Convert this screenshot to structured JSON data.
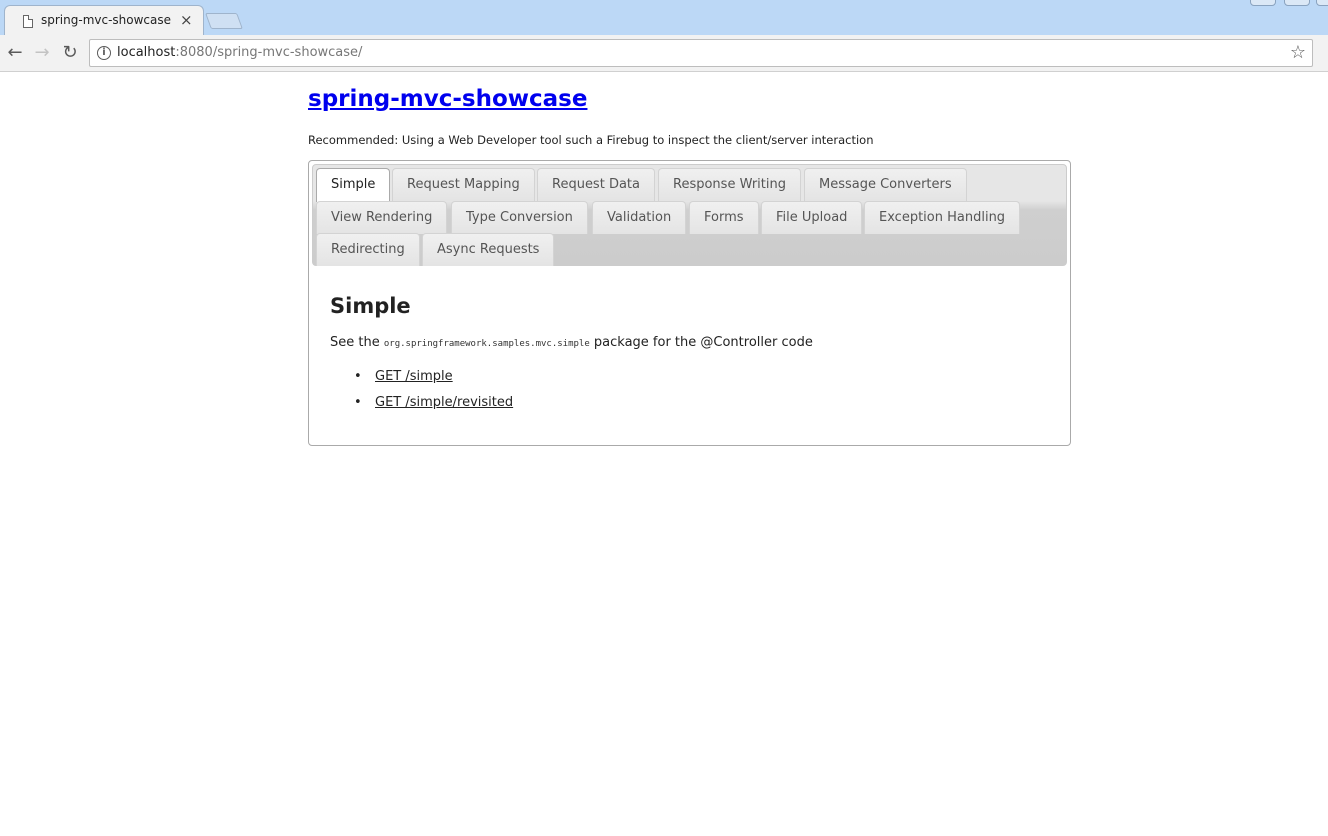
{
  "browser": {
    "tab_title": "spring-mvc-showcase",
    "close_glyph": "×",
    "url_host": "localhost",
    "url_rest": ":8080/spring-mvc-showcase/",
    "back_glyph": "←",
    "forward_glyph": "→",
    "reload_glyph": "↻",
    "info_glyph": "i",
    "star_glyph": "☆"
  },
  "page": {
    "title": "spring-mvc-showcase",
    "recommendation": "Recommended: Using a Web Developer tool such a Firebug to inspect the client/server interaction"
  },
  "tabs": [
    {
      "label": "Simple",
      "active": true
    },
    {
      "label": "Request Mapping"
    },
    {
      "label": "Request Data"
    },
    {
      "label": "Response Writing"
    },
    {
      "label": "Message Converters"
    },
    {
      "label": "View Rendering"
    },
    {
      "label": "Type Conversion"
    },
    {
      "label": "Validation"
    },
    {
      "label": "Forms"
    },
    {
      "label": "File Upload"
    },
    {
      "label": "Exception Handling"
    },
    {
      "label": "Redirecting"
    },
    {
      "label": "Async Requests"
    }
  ],
  "panel": {
    "heading": "Simple",
    "desc_prefix": "See the",
    "package_name": "org.springframework.samples.mvc.simple",
    "desc_suffix": "package for the @Controller code",
    "links": [
      "GET /simple",
      "GET /simple/revisited"
    ]
  },
  "colors": {
    "link": "#0000ee",
    "tabstrip": "#bcd8f6"
  }
}
